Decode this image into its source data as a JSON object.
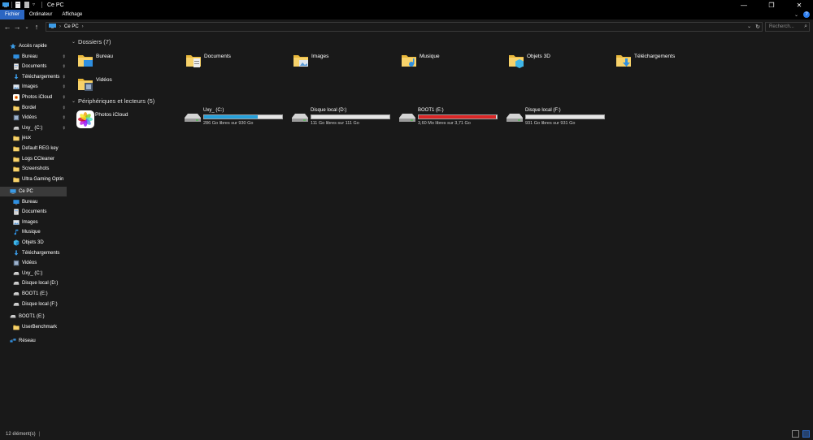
{
  "window": {
    "title": "Ce PC"
  },
  "titlebar": {
    "minimize": "—",
    "maximize": "❐",
    "close": "✕"
  },
  "ribbon": {
    "tabs": [
      "Fichier",
      "Ordinateur",
      "Affichage"
    ],
    "active_tab": "Fichier",
    "help": "?"
  },
  "nav": {
    "back": "←",
    "forward": "→",
    "recent": "⌄",
    "up": "↑"
  },
  "address": {
    "path_item": "Ce PC",
    "chevron": "›",
    "refresh": "↻",
    "dropdown": "⌄"
  },
  "search": {
    "placeholder": "Recherch...",
    "icon": "⌕"
  },
  "sidebar": {
    "quick_access_label": "Accès rapide",
    "quick_items": [
      {
        "label": "Bureau",
        "icon": "desktop-icon",
        "pinned": true
      },
      {
        "label": "Documents",
        "icon": "documents-icon",
        "pinned": true
      },
      {
        "label": "Téléchargements",
        "icon": "download-icon",
        "pinned": true
      },
      {
        "label": "Images",
        "icon": "images-icon",
        "pinned": true
      },
      {
        "label": "Photos iCloud",
        "icon": "icloud-photos-icon",
        "pinned": true
      },
      {
        "label": "Bordel",
        "icon": "folder-icon",
        "pinned": true
      },
      {
        "label": "Vidéos",
        "icon": "videos-icon",
        "pinned": true
      },
      {
        "label": "Uxy_ (C:)",
        "icon": "drive-icon",
        "pinned": true
      },
      {
        "label": "jeux",
        "icon": "folder-icon",
        "pinned": false
      },
      {
        "label": "Default REG key",
        "icon": "folder-icon",
        "pinned": false
      },
      {
        "label": "Logs CCleaner",
        "icon": "folder-icon",
        "pinned": false
      },
      {
        "label": "Screenshots",
        "icon": "folder-icon",
        "pinned": false
      },
      {
        "label": "Ultra Gaming Optin",
        "icon": "folder-icon",
        "pinned": false
      }
    ],
    "this_pc_label": "Ce PC",
    "pc_items": [
      {
        "label": "Bureau",
        "icon": "desktop-icon"
      },
      {
        "label": "Documents",
        "icon": "documents-icon"
      },
      {
        "label": "Images",
        "icon": "images-icon"
      },
      {
        "label": "Musique",
        "icon": "music-icon"
      },
      {
        "label": "Objets 3D",
        "icon": "objects-3d-icon"
      },
      {
        "label": "Téléchargements",
        "icon": "download-icon"
      },
      {
        "label": "Vidéos",
        "icon": "videos-icon"
      },
      {
        "label": "Uxy_ (C:)",
        "icon": "drive-icon"
      },
      {
        "label": "Disque local (D:)",
        "icon": "drive-icon"
      },
      {
        "label": "BOOT1 (E:)",
        "icon": "drive-icon"
      },
      {
        "label": "Disque local (F:)",
        "icon": "drive-icon"
      }
    ],
    "boot_label": "BOOT1 (E:)",
    "boot_child": "UserBenchmark",
    "network_label": "Réseau",
    "pin_glyph": "📌"
  },
  "main": {
    "folders_header": "Dossiers (7)",
    "folders": [
      {
        "label": "Bureau",
        "icon": "desktop-folder-icon"
      },
      {
        "label": "Documents",
        "icon": "documents-folder-icon"
      },
      {
        "label": "Images",
        "icon": "images-folder-icon"
      },
      {
        "label": "Musique",
        "icon": "music-folder-icon"
      },
      {
        "label": "Objets 3D",
        "icon": "objects-3d-folder-icon"
      },
      {
        "label": "Téléchargements",
        "icon": "download-folder-icon"
      },
      {
        "label": "Vidéos",
        "icon": "videos-folder-icon"
      }
    ],
    "devices_header": "Périphériques et lecteurs (5)",
    "icloud": {
      "label": "Photos iCloud",
      "icon": "icloud-photos-icon"
    },
    "drives": [
      {
        "label": "Uxy_ (C:)",
        "free": "286 Go libres sur 930 Go",
        "used_fraction": 0.69,
        "color": "#26a0da"
      },
      {
        "label": "Disque local (D:)",
        "free": "111 Go libres sur 111 Go",
        "used_fraction": 0.0,
        "color": "#26a0da"
      },
      {
        "label": "BOOT1 (E:)",
        "free": "3,60 Mo libres sur 3,71 Go",
        "used_fraction": 0.99,
        "color": "#da2626"
      },
      {
        "label": "Disque local (F:)",
        "free": "931 Go libres sur 931 Go",
        "used_fraction": 0.0,
        "color": "#26a0da"
      }
    ]
  },
  "status": {
    "count": "12 élément(s)",
    "sep": "|"
  }
}
